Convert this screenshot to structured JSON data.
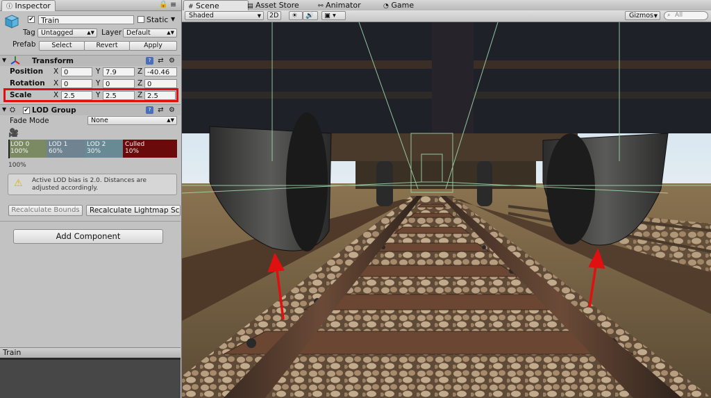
{
  "tabs": {
    "inspector": "Inspector",
    "scene": "Scene",
    "asset_store": "Asset Store",
    "animator": "Animator",
    "game": "Game"
  },
  "header": {
    "object_name": "Train",
    "active_checked": true,
    "static_label": "Static",
    "tag_label": "Tag",
    "tag_value": "Untagged",
    "layer_label": "Layer",
    "layer_value": "Default",
    "prefab_label": "Prefab",
    "select_label": "Select",
    "revert_label": "Revert",
    "apply_label": "Apply"
  },
  "transform": {
    "title": "Transform",
    "position": {
      "label": "Position",
      "x": "0",
      "y": "7.9",
      "z": "-40.46"
    },
    "rotation": {
      "label": "Rotation",
      "x": "0",
      "y": "0",
      "z": "0"
    },
    "scale": {
      "label": "Scale",
      "x": "2.5",
      "y": "2.5",
      "z": "2.5"
    },
    "axis_x": "X",
    "axis_y": "Y",
    "axis_z": "Z",
    "highlight_color": "#e01010"
  },
  "lod_group": {
    "title": "LOD Group",
    "fade_mode_label": "Fade Mode",
    "fade_mode_value": "None",
    "levels": [
      {
        "name": "LOD 0",
        "percent": "100%",
        "color": "#7c8a63"
      },
      {
        "name": "LOD 1",
        "percent": "60%",
        "color": "#6f8390"
      },
      {
        "name": "LOD 2",
        "percent": "30%",
        "color": "#688a94"
      },
      {
        "name": "Culled",
        "percent": "10%",
        "color": "#6b0a0a"
      }
    ],
    "current_percent": "100%",
    "warning": "Active LOD bias is 2.0. Distances are adjusted accordingly.",
    "recalc_bounds": "Recalculate Bounds",
    "recalc_lightmap": "Recalculate Lightmap Scal"
  },
  "add_component": "Add Component",
  "preview": {
    "title": "Train"
  },
  "scene_toolbar": {
    "shading": "Shaded",
    "mode_2d": "2D",
    "gizmos": "Gizmos",
    "search_placeholder": "All"
  }
}
